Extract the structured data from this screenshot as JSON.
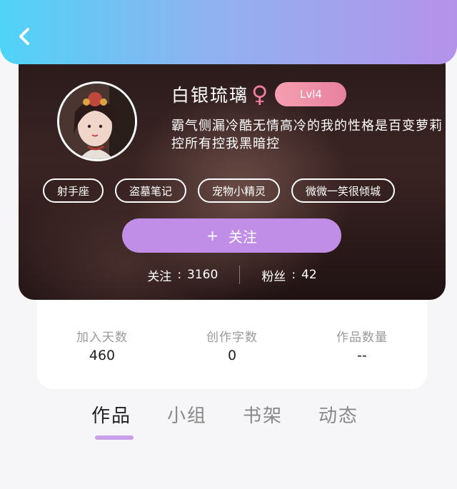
{
  "header": {
    "back_icon": "chevron-left-icon",
    "gradient": [
      "#4fd3f7",
      "#b592ea"
    ]
  },
  "profile": {
    "avatar_icon": "avatar",
    "name": "白银琉璃",
    "gender_icon": "female-icon",
    "gender_symbol": "♀",
    "level": "Lvl4",
    "bio": "霸气侧漏冷酷无情高冷的我的性格是百变萝莉控所有控我黑暗控",
    "tags": [
      "射手座",
      "盗墓笔记",
      "宠物小精灵",
      "微微一笑很倾城"
    ],
    "follow_plus": "+",
    "follow_label": "关注",
    "following_label": "关注",
    "following_count": "3160",
    "fans_label": "粉丝",
    "fans_count": "42",
    "stat_sep": ":"
  },
  "info": {
    "joined_label": "加入天数",
    "joined_value": "460",
    "words_label": "创作字数",
    "words_value": "0",
    "works_label": "作品数量",
    "works_value": "--"
  },
  "tabs": [
    "作品",
    "小组",
    "书架",
    "动态"
  ],
  "colors": {
    "accent": "#c08ee6",
    "badge": "#e880a0",
    "gender": "#f07da0",
    "tab_underline": "#c8a0ea"
  }
}
